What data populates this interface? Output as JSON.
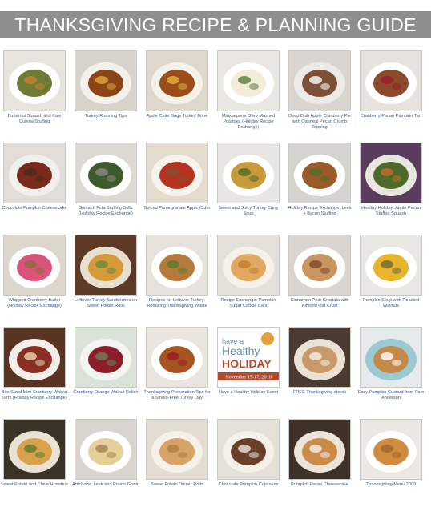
{
  "header": {
    "title": "THANKSGIVING RECIPE & PLANNING GUIDE"
  },
  "recipes": [
    {
      "caption": "Butternut Squash and Kale Quinoa Stuffing",
      "icon": "squash-kale-stuffing-photo",
      "bg": "#e7e4de",
      "plate": "#ffffff",
      "food": "#6e7b34",
      "accent": "#c8822f"
    },
    {
      "caption": "Turkey Roasting Tips",
      "icon": "roast-turkey-photo",
      "bg": "#d8d3ca",
      "plate": "#f4f1ea",
      "food": "#8b4418",
      "accent": "#e2a63c"
    },
    {
      "caption": "Apple Cider Sage Turkey Brine",
      "icon": "roast-turkey-photo",
      "bg": "#ddd7cc",
      "plate": "#f5f2ea",
      "food": "#9a4c1b",
      "accent": "#e3b23f"
    },
    {
      "caption": "Mascarpone Olive Mashed Potatoes (Holiday Recipe Exchange)",
      "icon": "mashed-potatoes-photo",
      "bg": "#e9e7e2",
      "plate": "#ffffff",
      "food": "#f2ecd9",
      "accent": "#5a7a3a"
    },
    {
      "caption": "Deep Dish Apple Cranberry Pie with Oatmeal Pecan Crumb Topping",
      "icon": "apple-pie-photo",
      "bg": "#d9d6d2",
      "plate": "#ecebe8",
      "food": "#7e5037",
      "accent": "#ffffff"
    },
    {
      "caption": "Cranberry Pecan Pumpkin Tart",
      "icon": "pumpkin-tart-photo",
      "bg": "#e6e3de",
      "plate": "#ffffff",
      "food": "#8a4a2b",
      "accent": "#9b1b2a"
    },
    {
      "caption": "Chocolate Pumpkin Cheesecake",
      "icon": "cheesecake-photo",
      "bg": "#e2ddd6",
      "plate": "#f2f0ec",
      "food": "#7a2c1c",
      "accent": "#4a2a1b"
    },
    {
      "caption": "Spinach Feta Stuffing Balls (Holiday Recipe Exchange)",
      "icon": "stuffing-balls-photo",
      "bg": "#dcd9d4",
      "plate": "#ffffff",
      "food": "#3f5a2c",
      "accent": "#8a8a8a"
    },
    {
      "caption": "Spiced Pomegranate Apple Cider",
      "icon": "cider-glass-photo",
      "bg": "#e4dccf",
      "plate": "#f7f3ea",
      "food": "#b5331f",
      "accent": "#7a5533"
    },
    {
      "caption": "Sweet and Spicy Turkey Curry Soup",
      "icon": "curry-soup-photo",
      "bg": "#e8e6e2",
      "plate": "#ffffff",
      "food": "#c99a3a",
      "accent": "#4e6b2c"
    },
    {
      "caption": "Holiday Recipe Exchange: Leek + Bacon Stuffing",
      "icon": "leek-stuffing-photo",
      "bg": "#d6d4d0",
      "plate": "#ffffff",
      "food": "#9a5a2a",
      "accent": "#4f6e2a"
    },
    {
      "caption": "Healthy Holiday: Apple Pecan Stuffed Squash",
      "icon": "stuffed-squash-photo",
      "bg": "#5a3d5c",
      "plate": "#e8e6e0",
      "food": "#4e6a2a",
      "accent": "#c46b2a"
    },
    {
      "caption": "Whipped Cranberry Butter (Holiday Recipe Exchange)",
      "icon": "cranberry-butter-photo",
      "bg": "#dcd6cc",
      "plate": "#ffffff",
      "food": "#d9537a",
      "accent": "#8f6a3f"
    },
    {
      "caption": "Leftover Turkey Sandwiches on Sweet Potato Rolls",
      "icon": "turkey-sandwich-photo",
      "bg": "#5c3a26",
      "plate": "#e8dfcf",
      "food": "#d79a3a",
      "accent": "#6a8a3a"
    },
    {
      "caption": "Recipes for Leftover Turkey: Reducing Thanksgiving Waste",
      "icon": "leftover-sandwich-photo",
      "bg": "#e6e3de",
      "plate": "#ffffff",
      "food": "#b57a3a",
      "accent": "#5b7a2f"
    },
    {
      "caption": "Recipe Exchange: Pumpkin Sugar Cookie Bars",
      "icon": "cookie-bars-photo",
      "bg": "#e4e0da",
      "plate": "#f6f2ea",
      "food": "#e1a861",
      "accent": "#c97b2e"
    },
    {
      "caption": "Cinnamon Pear Crostata with Almond Oat Crust",
      "icon": "pear-crostata-photo",
      "bg": "#d9d6d2",
      "plate": "#ffffff",
      "food": "#c99560",
      "accent": "#7a4a2a"
    },
    {
      "caption": "Pumpkin Soup with Roasted Walnuts",
      "icon": "pumpkin-soup-photo",
      "bg": "#e9e7e3",
      "plate": "#ffffff",
      "food": "#e8b52a",
      "accent": "#6a6a3a"
    },
    {
      "caption": "Bite Sized Mini Cranberry Walnut Tarts (Holiday Recipe Exchange)",
      "icon": "mini-tarts-photo",
      "bg": "#5a3422",
      "plate": "#f3efe8",
      "food": "#8b2f22",
      "accent": "#e8d7b5"
    },
    {
      "caption": "Cranberry Orange Walnut Relish",
      "icon": "cranberry-relish-photo",
      "bg": "#dbe2d8",
      "plate": "#f4f4f0",
      "food": "#8a1f2a",
      "accent": "#6a7f5a"
    },
    {
      "caption": "Thanksgiving Preparation Tips for a Stress-Free Turkey Day",
      "icon": "turkey-platter-photo",
      "bg": "#e9e6e0",
      "plate": "#ffffff",
      "food": "#a65520",
      "accent": "#9b1b2a"
    },
    {
      "caption": "Have a Healthy Holiday Event",
      "icon": "healthy-holiday-badge",
      "bg": "#ffffff",
      "plate": "#ffffff",
      "food": "#b54a2a",
      "accent": "#6e8fa8"
    },
    {
      "caption": "FREE Thanksgiving ebook",
      "icon": "parfait-photo",
      "bg": "#4a3b30",
      "plate": "#e9e2d5",
      "food": "#c89a6a",
      "accent": "#f3efe6"
    },
    {
      "caption": "Easy Pumpkin Custard from Pam Anderson",
      "icon": "custard-cup-photo",
      "bg": "#e6eaea",
      "plate": "#9ccad2",
      "food": "#c58a4a",
      "accent": "#ffffff"
    },
    {
      "caption": "Sweet Potato and Chive Hummus",
      "icon": "hummus-photo",
      "bg": "#3a3326",
      "plate": "#e8e2d2",
      "food": "#d7a24a",
      "accent": "#5b7a2a"
    },
    {
      "caption": "Artichoke, Leek and Potato Gratin",
      "icon": "gratin-photo",
      "bg": "#d8d5cf",
      "plate": "#ffffff",
      "food": "#e6d09a",
      "accent": "#a0834f"
    },
    {
      "caption": "Sweet Potato Dinner Rolls",
      "icon": "dinner-rolls-photo",
      "bg": "#e2dcd2",
      "plate": "#f6f1e8",
      "food": "#d5a466",
      "accent": "#b07c42"
    },
    {
      "caption": "Chocolate Pumpkin Cupcakes",
      "icon": "cupcakes-photo",
      "bg": "#e6e1d8",
      "plate": "#f5f0e8",
      "food": "#6a3f2a",
      "accent": "#f0e6d6"
    },
    {
      "caption": "Pumpkin Pecan Cheesecake",
      "icon": "cheesecake-cup-photo",
      "bg": "#3e3228",
      "plate": "#ece4d6",
      "food": "#c98a4a",
      "accent": "#f4efe6"
    },
    {
      "caption": "Thanksgiving Menu 2009",
      "icon": "menu-pie-photo",
      "bg": "#ebe8e3",
      "plate": "#ffffff",
      "food": "#cf8b3e",
      "accent": "#a0632a"
    }
  ],
  "badge": {
    "line1": "have a",
    "line2": "Healthy",
    "line3": "HOLIDAY",
    "dates": "November 15-17, 2010"
  }
}
